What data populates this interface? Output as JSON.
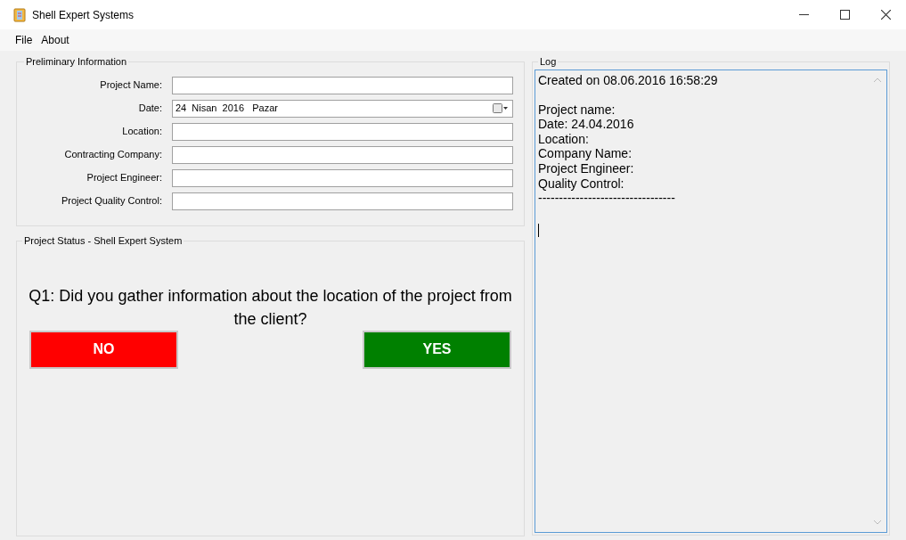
{
  "window": {
    "title": "Shell Expert Systems"
  },
  "menu": [
    "File",
    "About"
  ],
  "preliminary": {
    "title": "Preliminary Information",
    "fields": [
      {
        "label": "Project Name:",
        "kind": "text"
      },
      {
        "label": "Date:",
        "kind": "date",
        "value": "24  Nisan  2016   Pazar"
      },
      {
        "label": "Location:",
        "kind": "text"
      },
      {
        "label": "Contracting Company:",
        "kind": "text"
      },
      {
        "label": "Project Engineer:",
        "kind": "text"
      },
      {
        "label": "Project Quality Control:",
        "kind": "text"
      }
    ]
  },
  "status": {
    "title": "Project Status - Shell Expert System",
    "question": "Q1: Did you gather information about the location of the project from the client?",
    "buttons": [
      {
        "label": "NO",
        "color": "#ff0000"
      },
      {
        "label": "YES",
        "color": "#008000"
      }
    ]
  },
  "log": {
    "title": "Log",
    "header": "Created on 08.06.2016 16:58:29",
    "lines": [
      "Project name:",
      "Date: 24.04.2016",
      "Location:",
      "Company Name:",
      "Project Engineer:",
      "Quality Control:",
      "---------------------------------"
    ]
  }
}
